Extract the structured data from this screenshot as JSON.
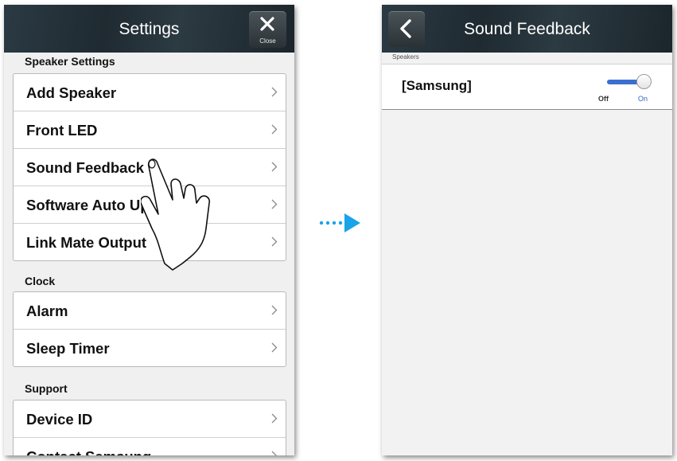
{
  "left_screen": {
    "title": "Settings",
    "close_label": "Close",
    "sections": [
      {
        "header": "Speaker Settings",
        "items": [
          "Add Speaker",
          "Front LED",
          "Sound Feedback",
          "Software Auto Up",
          "Link Mate Output"
        ]
      },
      {
        "header": "Clock",
        "items": [
          "Alarm",
          "Sleep Timer"
        ]
      },
      {
        "header": "Support",
        "items": [
          "Device ID",
          "Contact Samsung"
        ]
      }
    ]
  },
  "right_screen": {
    "title": "Sound Feedback",
    "section_header": "Speakers",
    "speaker_name": "[Samsung]",
    "toggle": {
      "off_label": "Off",
      "on_label": "On",
      "state": "on"
    }
  },
  "colors": {
    "titlebar": "#1f2a31",
    "arrow": "#1aa3e8",
    "toggle_on": "#3a6fd0"
  },
  "icons": [
    "close-icon",
    "back-icon",
    "chevron-right-icon",
    "tap-hand-icon",
    "dotted-arrow-icon"
  ]
}
